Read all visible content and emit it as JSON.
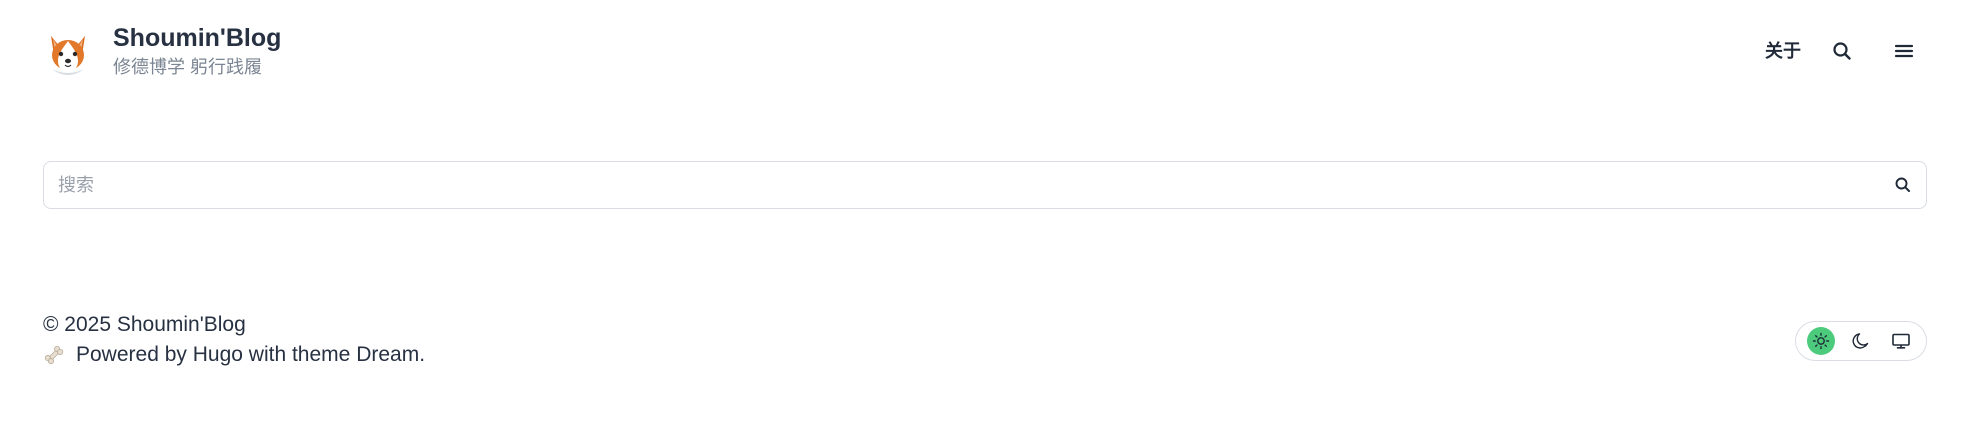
{
  "header": {
    "site_title": "Shoumin'Blog",
    "site_subtitle": "修德博学 躬行践履",
    "nav": {
      "about_label": "关于"
    }
  },
  "search": {
    "placeholder": "搜索",
    "value": ""
  },
  "footer": {
    "copyright": "© 2025 Shoumin'Blog",
    "powered_prefix": "Powered by",
    "hugo_link": "Hugo",
    "powered_middle": "with theme",
    "theme_link": "Dream",
    "powered_suffix": "."
  },
  "theme_switch": {
    "options": [
      {
        "icon": "sun-icon",
        "active": true
      },
      {
        "icon": "moon-icon",
        "active": false
      },
      {
        "icon": "monitor-icon",
        "active": false
      }
    ],
    "active_color": "#4ccb7c"
  },
  "colors": {
    "text": "#273142",
    "muted": "#7b8593",
    "border": "#d9dde3",
    "accent": "#4ccb7c"
  }
}
